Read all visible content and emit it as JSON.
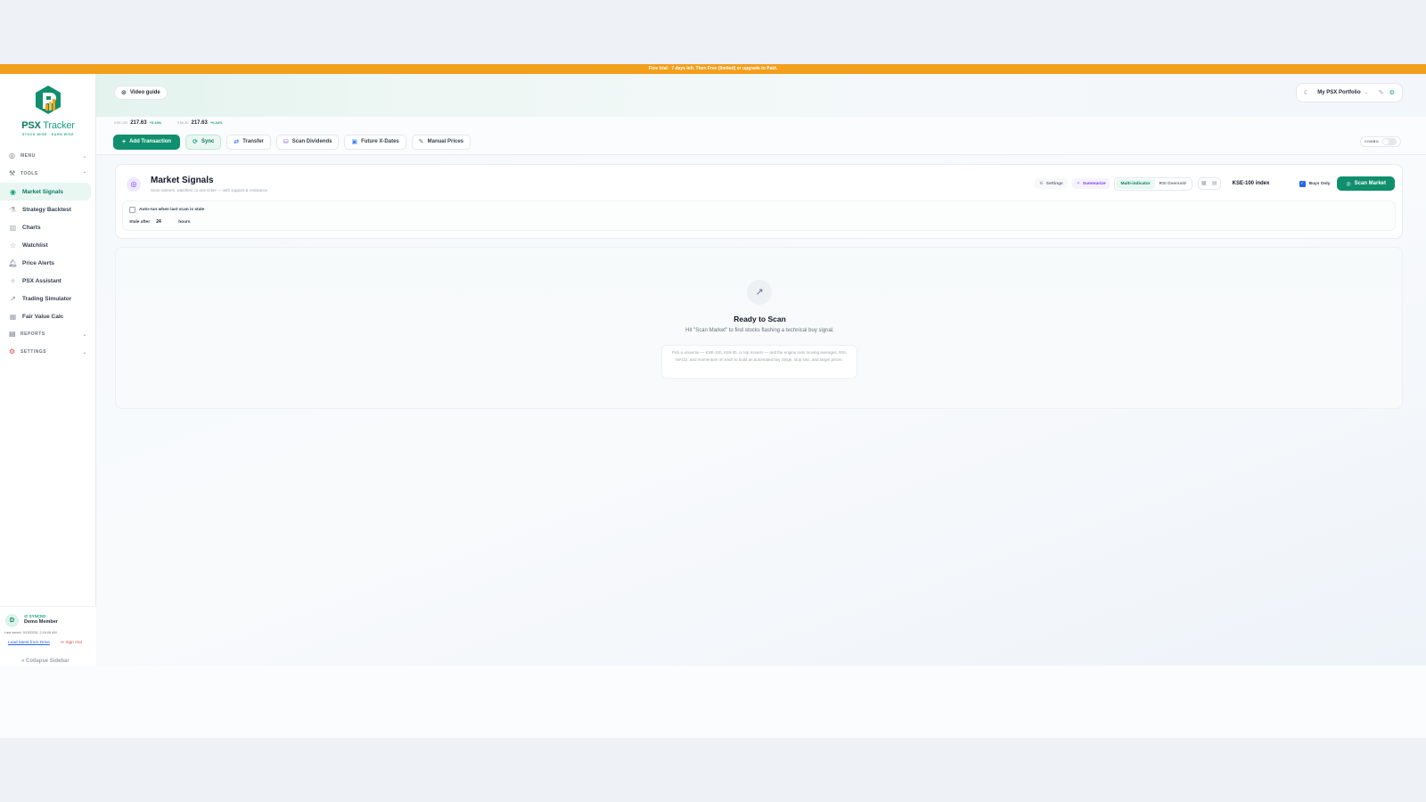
{
  "banner": "Free trial · 7 days left. Then Free (limited) or upgrade to Paid.",
  "brand": {
    "name_a": "PSX",
    "name_b": " Tracker",
    "tagline": "STOCK WISE · EARN WISE",
    "color": "#0b7a63"
  },
  "sidebar": {
    "menu_label": "MENU",
    "tools_label": "TOOLS",
    "items": [
      {
        "label": "Market Signals",
        "icon": "signal-icon"
      },
      {
        "label": "Strategy Backtest",
        "icon": "flask-icon"
      },
      {
        "label": "Charts",
        "icon": "chart-icon"
      },
      {
        "label": "Watchlist",
        "icon": "star-icon"
      },
      {
        "label": "Price Alerts",
        "icon": "bell-icon"
      },
      {
        "label": "PSX Assistant",
        "icon": "sparkle-icon"
      },
      {
        "label": "Trading Simulator",
        "icon": "trend-icon"
      },
      {
        "label": "Fair Value Calc",
        "icon": "calculator-icon"
      }
    ],
    "reports_label": "REPORTS",
    "settings_label": "SETTINGS",
    "user": {
      "initial": "D",
      "handle": "@ SYNCED",
      "name": "Demo Member",
      "last_saved": "Last saved: 9/15/2026, 2:16:08 AM",
      "load_link": "Load latest from Drive",
      "sign_out": "Sign Out"
    },
    "collapse": "Collapse Sidebar"
  },
  "header": {
    "video_guide": "Video guide",
    "portfolio": "My PSX Portfolio"
  },
  "tickers": [
    {
      "name": "KSE-100",
      "value": "217.63",
      "change": "+0.34%"
    },
    {
      "name": "KMI-30",
      "value": "217.63",
      "change": "+0.34%"
    }
  ],
  "toolbar": {
    "add": "Add Transaction",
    "sync": "Sync",
    "transfer": "Transfer",
    "dividends": "Scan Dividends",
    "xdates": "Future X-Dates",
    "manual": "Manual Prices",
    "combo": "COMBO"
  },
  "signals": {
    "title": "Market Signals",
    "subtitle": "Scan indexes, watchlist, or one ticker — with support & resistance",
    "settings": "Settings",
    "summarize": "Summarize",
    "mode_multi": "Multi-indicator",
    "mode_rsi": "RSI Oversold",
    "universe": "KSE-100 index",
    "buys_only": "Buys Only",
    "scan": "Scan Market",
    "auto_run": "Auto-run when last scan is stale",
    "stale_after": "Stale after",
    "stale_value": "24",
    "stale_unit": "hours"
  },
  "ready": {
    "title": "Ready to Scan",
    "subtitle": "Hit \"Scan Market\" to find stocks flashing a technical buy signal.",
    "note": "Pick a universe — KSE-100, KMI-30, or top movers — and the engine runs moving averages, RSI, MACD, and momentum on each to build an automated buy range, stop loss, and target prices."
  }
}
